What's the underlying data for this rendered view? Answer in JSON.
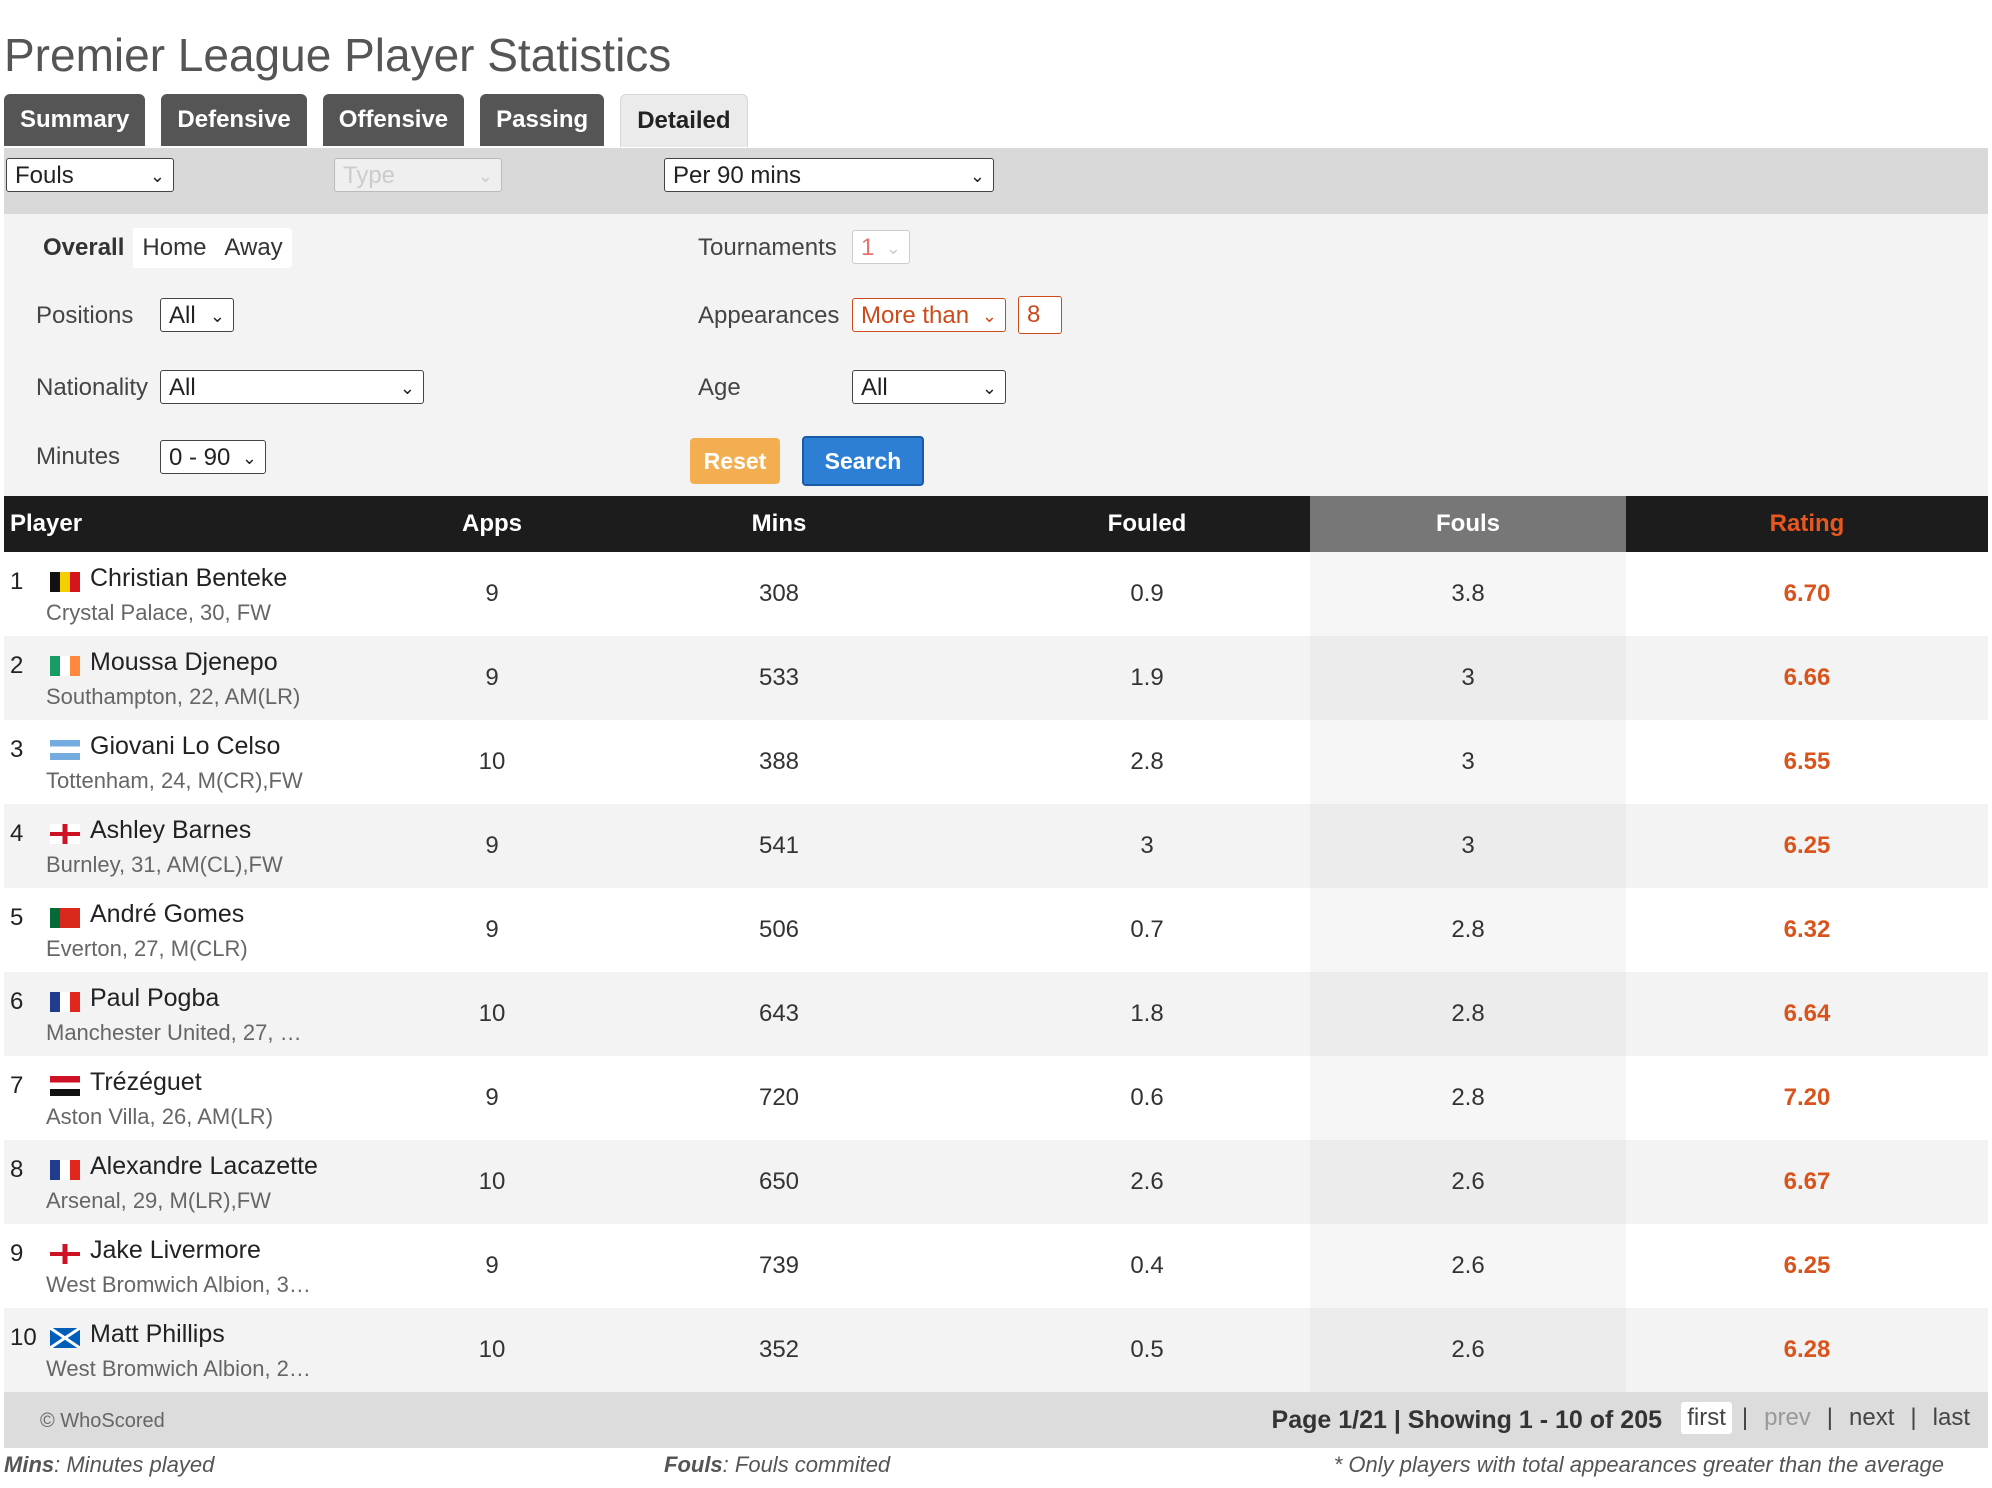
{
  "page": {
    "title": "Premier League Player Statistics"
  },
  "tabs": [
    "Summary",
    "Defensive",
    "Offensive",
    "Passing",
    "Detailed"
  ],
  "active_tab": "Detailed",
  "filter_bar": {
    "category": "Fouls",
    "type": "Type",
    "per": "Per 90 mins"
  },
  "filters": {
    "venue": [
      "Overall",
      "Home",
      "Away"
    ],
    "active_venue": "Overall",
    "positions_label": "Positions",
    "positions_value": "All",
    "nationality_label": "Nationality",
    "nationality_value": "All",
    "minutes_label": "Minutes",
    "minutes_value": "0 - 90",
    "tournaments_label": "Tournaments",
    "tournaments_value": "1",
    "appearances_label": "Appearances",
    "appearances_op": "More than",
    "appearances_value": "8",
    "age_label": "Age",
    "age_value": "All",
    "reset_label": "Reset",
    "search_label": "Search"
  },
  "table": {
    "columns": [
      "Player",
      "Apps",
      "Mins",
      "Fouled",
      "Fouls",
      "Rating"
    ],
    "highlight_column": "Fouls",
    "rows": [
      {
        "rank": "1",
        "flag": "belgium",
        "name": "Christian Benteke",
        "meta": "Crystal Palace,  30, FW",
        "apps": "9",
        "mins": "308",
        "fouled": "0.9",
        "fouls": "3.8",
        "rating": "6.70"
      },
      {
        "rank": "2",
        "flag": "ireland",
        "name": "Moussa Djenepo",
        "meta": "Southampton,  22, AM(LR)",
        "apps": "9",
        "mins": "533",
        "fouled": "1.9",
        "fouls": "3",
        "rating": "6.66"
      },
      {
        "rank": "3",
        "flag": "argentina",
        "name": "Giovani Lo Celso",
        "meta": "Tottenham,  24, M(CR),FW",
        "apps": "10",
        "mins": "388",
        "fouled": "2.8",
        "fouls": "3",
        "rating": "6.55"
      },
      {
        "rank": "4",
        "flag": "england",
        "name": "Ashley Barnes",
        "meta": "Burnley,  31, AM(CL),FW",
        "apps": "9",
        "mins": "541",
        "fouled": "3",
        "fouls": "3",
        "rating": "6.25"
      },
      {
        "rank": "5",
        "flag": "portugal",
        "name": "André Gomes",
        "meta": "Everton,  27, M(CLR)",
        "apps": "9",
        "mins": "506",
        "fouled": "0.7",
        "fouls": "2.8",
        "rating": "6.32"
      },
      {
        "rank": "6",
        "flag": "france",
        "name": "Paul Pogba",
        "meta": "Manchester United,  27, …",
        "apps": "10",
        "mins": "643",
        "fouled": "1.8",
        "fouls": "2.8",
        "rating": "6.64"
      },
      {
        "rank": "7",
        "flag": "egypt",
        "name": "Trézéguet",
        "meta": "Aston Villa,  26, AM(LR)",
        "apps": "9",
        "mins": "720",
        "fouled": "0.6",
        "fouls": "2.8",
        "rating": "7.20"
      },
      {
        "rank": "8",
        "flag": "france",
        "name": "Alexandre Lacazette",
        "meta": "Arsenal,  29, M(LR),FW",
        "apps": "10",
        "mins": "650",
        "fouled": "2.6",
        "fouls": "2.6",
        "rating": "6.67"
      },
      {
        "rank": "9",
        "flag": "england",
        "name": "Jake Livermore",
        "meta": "West Bromwich Albion,  3…",
        "apps": "9",
        "mins": "739",
        "fouled": "0.4",
        "fouls": "2.6",
        "rating": "6.25"
      },
      {
        "rank": "10",
        "flag": "scotland",
        "name": "Matt Phillips",
        "meta": "West Bromwich Albion,  2…",
        "apps": "10",
        "mins": "352",
        "fouled": "0.5",
        "fouls": "2.6",
        "rating": "6.28"
      }
    ]
  },
  "footer": {
    "copyright": "© WhoScored",
    "page_info": "Page 1/21 | Showing 1 - 10 of 205",
    "pager": [
      "first",
      "prev",
      "next",
      "last"
    ]
  },
  "legend": {
    "mins_key": "Mins",
    "mins_text": ": Minutes played",
    "fouls_key": "Fouls",
    "fouls_text": ": Fouls commited",
    "note": "* Only players with total appearances greater than the average"
  },
  "colors": {
    "accent": "#d9541c",
    "search": "#2d7fd6",
    "reset": "#f4ae52"
  }
}
